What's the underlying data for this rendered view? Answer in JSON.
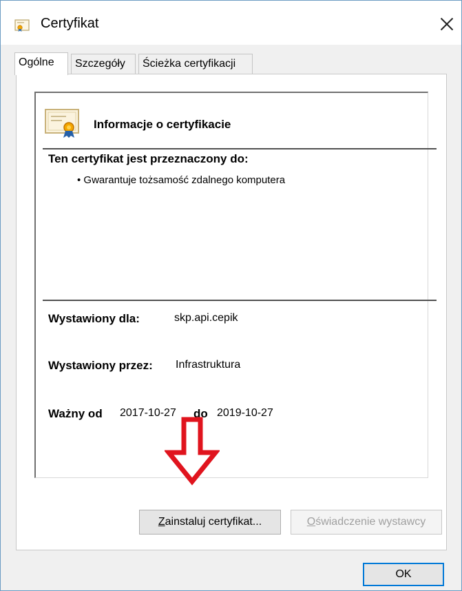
{
  "window": {
    "title": "Certyfikat",
    "close_symbol": "close-icon"
  },
  "tabs": [
    {
      "label": "Ogólne",
      "active": true
    },
    {
      "label": "Szczegóły",
      "active": false
    },
    {
      "label": "Ścieżka certyfikacji",
      "active": false
    }
  ],
  "info": {
    "heading": "Informacje o certyfikacie",
    "purpose_heading": "Ten certyfikat jest przeznaczony do:",
    "purposes": [
      "• Gwarantuje tożsamość zdalnego komputera"
    ],
    "issued_to_label": "Wystawiony dla:",
    "issued_to_value": "skp.api.cepik",
    "issued_by_label": "Wystawiony przez:",
    "issued_by_value": "Infrastruktura",
    "valid_from_label": "Ważny od",
    "valid_from_value": "2017-10-27",
    "valid_to_label": "do",
    "valid_to_value": "2019-10-27"
  },
  "buttons": {
    "install_first": "Z",
    "install_rest": "ainstaluj certyfikat...",
    "issuer_first": "O",
    "issuer_rest": "świadczenie wystawcy",
    "ok": "OK"
  },
  "colors": {
    "window_border": "#6b9bc3",
    "dialog_bg": "#f0f0f0",
    "arrow_red": "#e0141e",
    "default_button_border": "#0078d7",
    "disabled_text": "#a0a0a0"
  }
}
